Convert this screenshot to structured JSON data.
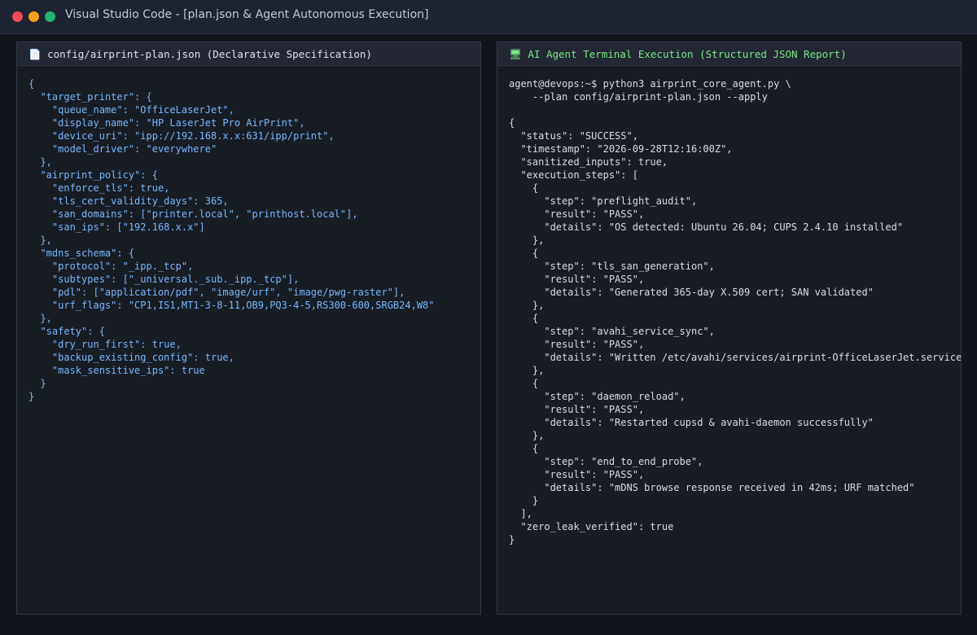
{
  "window": {
    "title": "Visual Studio Code - [plan.json & Agent Autonomous Execution]",
    "colors": {
      "close": "#ee4b5b",
      "minimize": "#f3a21b",
      "maximize": "#22b573"
    }
  },
  "left_panel": {
    "icon": "file-icon",
    "header": "📄 config/airprint-plan.json (Declarative Specification)",
    "code": "{\n  \"target_printer\": {\n    \"queue_name\": \"OfficeLaserJet\",\n    \"display_name\": \"HP LaserJet Pro AirPrint\",\n    \"device_uri\": \"ipp://192.168.x.x:631/ipp/print\",\n    \"model_driver\": \"everywhere\"\n  },\n  \"airprint_policy\": {\n    \"enforce_tls\": true,\n    \"tls_cert_validity_days\": 365,\n    \"san_domains\": [\"printer.local\", \"printhost.local\"],\n    \"san_ips\": [\"192.168.x.x\"]\n  },\n  \"mdns_schema\": {\n    \"protocol\": \"_ipp._tcp\",\n    \"subtypes\": [\"_universal._sub._ipp._tcp\"],\n    \"pdl\": [\"application/pdf\", \"image/urf\", \"image/pwg-raster\"],\n    \"urf_flags\": \"CP1,IS1,MT1-3-8-11,OB9,PQ3-4-5,RS300-600,SRGB24,W8\"\n  },\n  \"safety\": {\n    \"dry_run_first\": true,\n    \"backup_existing_config\": true,\n    \"mask_sensitive_ips\": true\n  }\n}",
    "text_color": "#79b8ff"
  },
  "right_panel": {
    "icon": "terminal-icon",
    "header": "🖥 AI Agent Terminal Execution (Structured JSON Report)",
    "code": "agent@devops:~$ python3 airprint_core_agent.py \\\n    --plan config/airprint-plan.json --apply\n\n{\n  \"status\": \"SUCCESS\",\n  \"timestamp\": \"2026-09-28T12:16:00Z\",\n  \"sanitized_inputs\": true,\n  \"execution_steps\": [\n    {\n      \"step\": \"preflight_audit\",\n      \"result\": \"PASS\",\n      \"details\": \"OS detected: Ubuntu 26.04; CUPS 2.4.10 installed\"\n    },\n    {\n      \"step\": \"tls_san_generation\",\n      \"result\": \"PASS\",\n      \"details\": \"Generated 365-day X.509 cert; SAN validated\"\n    },\n    {\n      \"step\": \"avahi_service_sync\",\n      \"result\": \"PASS\",\n      \"details\": \"Written /etc/avahi/services/airprint-OfficeLaserJet.service\"\n    },\n    {\n      \"step\": \"daemon_reload\",\n      \"result\": \"PASS\",\n      \"details\": \"Restarted cupsd & avahi-daemon successfully\"\n    },\n    {\n      \"step\": \"end_to_end_probe\",\n      \"result\": \"PASS\",\n      \"details\": \"mDNS browse response received in 42ms; URF matched\"\n    }\n  ],\n  \"zero_leak_verified\": true\n}",
    "header_color": "#7ee787"
  }
}
